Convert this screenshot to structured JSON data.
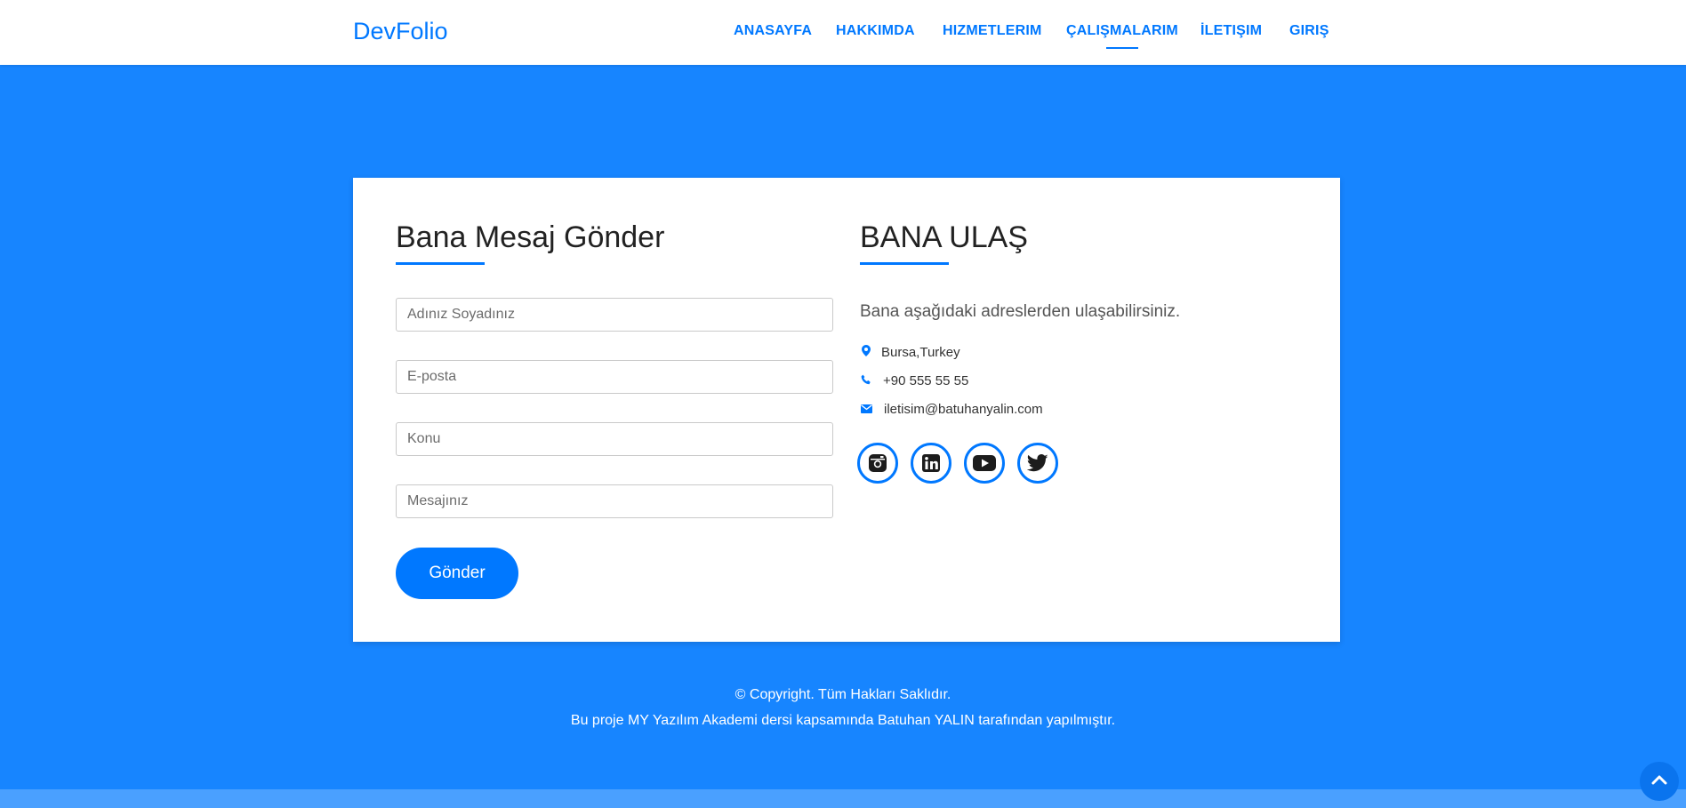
{
  "brand": "DevFolio",
  "nav": [
    "ANASAYFA",
    "HAKKIMDA",
    "HIZMETLERIM",
    "ÇALIŞMALARIM",
    "İLETIŞIM",
    "GIRIŞ"
  ],
  "form": {
    "title": "Bana Mesaj Gönder",
    "name_placeholder": "Adınız Soyadınız",
    "email_placeholder": "E-posta",
    "subject_placeholder": "Konu",
    "message_placeholder": "Mesajınız",
    "submit_label": "Gönder"
  },
  "contact": {
    "title": "BANA ULAŞ",
    "lead": "Bana aşağıdaki adreslerden ulaşabilirsiniz.",
    "location": "Bursa,Turkey",
    "phone": "+90 555 55 55",
    "email": "iletisim@batuhanyalin.com",
    "socials": [
      "instagram-icon",
      "linkedin-icon",
      "youtube-icon",
      "twitter-icon"
    ]
  },
  "footer": {
    "copyright": "© Copyright. Tüm Hakları Saklıdır.",
    "credit": "Bu proje MY Yazılım Akademi dersi kapsamında Batuhan YALIN tarafından yapılmıştır."
  },
  "colors": {
    "accent": "#0078ff",
    "background": "#1785ff"
  }
}
